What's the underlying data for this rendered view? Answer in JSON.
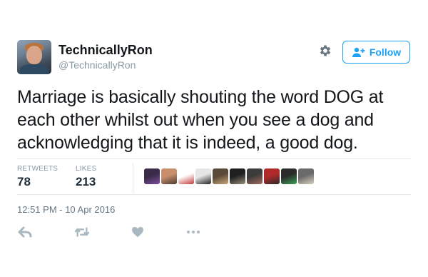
{
  "user": {
    "display_name": "TechnicallyRon",
    "handle": "@TechnicallyRon"
  },
  "follow_button": {
    "label": "Follow"
  },
  "tweet": {
    "text_lines": [
      "Marriage is basically shouting the word DOG at",
      "each other whilst out when you see a dog and",
      "acknowledging that it is indeed, a good dog."
    ],
    "timestamp": "12:51 PM - 10 Apr 2016"
  },
  "stats": {
    "retweets_label": "RETWEETS",
    "retweets_count": "78",
    "likes_label": "LIKES",
    "likes_count": "213"
  },
  "liker_avatars": [
    {
      "colors": [
        "#3a2b4a",
        "#7d4e9c"
      ]
    },
    {
      "colors": [
        "#c98f6c",
        "#4a3a30"
      ]
    },
    {
      "colors": [
        "#ffffff",
        "#c23a3a"
      ]
    },
    {
      "colors": [
        "#e6e6e6",
        "#222222"
      ]
    },
    {
      "colors": [
        "#5a4a3a",
        "#c9a77a"
      ]
    },
    {
      "colors": [
        "#202020",
        "#9a8f7a"
      ]
    },
    {
      "colors": [
        "#3c3c3c",
        "#a06a5a"
      ]
    },
    {
      "colors": [
        "#b02a2a",
        "#2a2a2a"
      ]
    },
    {
      "colors": [
        "#2b2b2b",
        "#3aa05a"
      ]
    },
    {
      "colors": [
        "#6a6a6a",
        "#d8d0c0"
      ]
    }
  ],
  "actions": [
    {
      "icon": "reply-icon"
    },
    {
      "icon": "retweet-icon"
    },
    {
      "icon": "like-icon"
    },
    {
      "icon": "more-icon"
    }
  ],
  "colors": {
    "brand_blue": "#1da1f2",
    "secondary_text": "#8899a6",
    "divider": "#e1e8ed",
    "icon_gray": "#aab8c2"
  }
}
